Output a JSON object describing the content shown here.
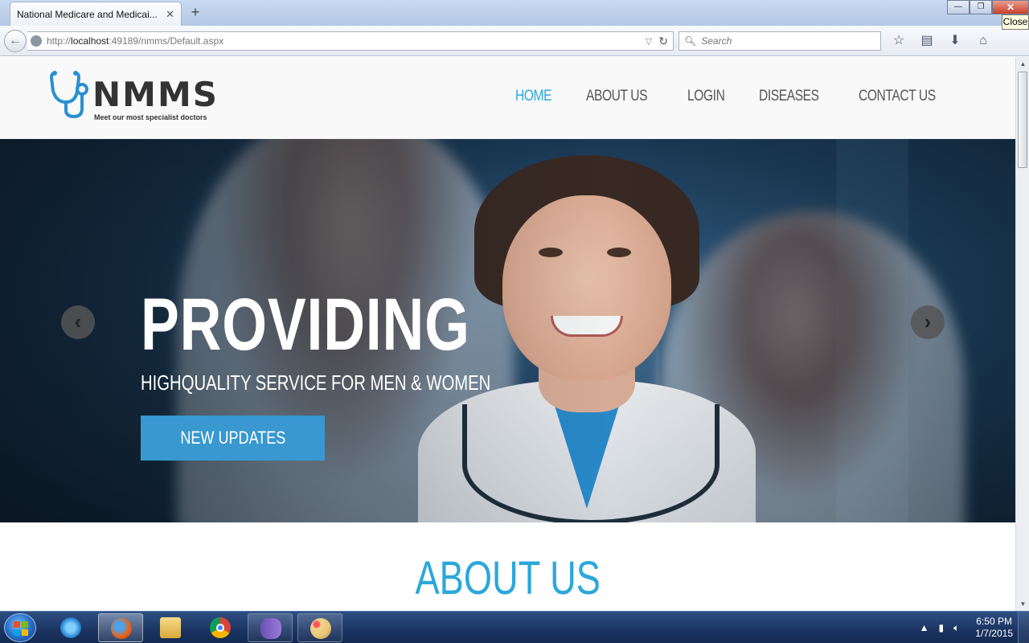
{
  "browser": {
    "tab_title": "National Medicare and Medicai...",
    "new_tab": "+",
    "tab_close": "✕",
    "url_scheme": "http://",
    "url_host": "localhost",
    "url_rest": ":49189/nmms/Default.aspx",
    "search_placeholder": "Search",
    "tooltip": "Close",
    "win_min": "—",
    "win_max": "❐",
    "win_close": "✕"
  },
  "site": {
    "logo_text": "NMMS",
    "tagline": "Meet our most specialist doctors",
    "nav": [
      {
        "label": "HOME",
        "active": true
      },
      {
        "label": "ABOUT US"
      },
      {
        "label": "LOGIN"
      },
      {
        "label": "DISEASES"
      },
      {
        "label": "CONTACT US"
      }
    ],
    "accent_color": "#2ba7dc",
    "button_color": "#3898cf"
  },
  "hero": {
    "title": "PROVIDING",
    "subtitle": "HIGHQUALITY SERVICE FOR MEN & WOMEN",
    "button": "NEW UPDATES",
    "prev_icon": "chevron-left-icon",
    "next_icon": "chevron-right-icon"
  },
  "about": {
    "title": "ABOUT US"
  },
  "taskbar": {
    "time": "6:50 PM",
    "date": "1/7/2015",
    "apps": [
      "internet-explorer-icon",
      "firefox-icon",
      "file-explorer-icon",
      "chrome-icon",
      "visual-studio-icon",
      "paint-icon"
    ]
  }
}
